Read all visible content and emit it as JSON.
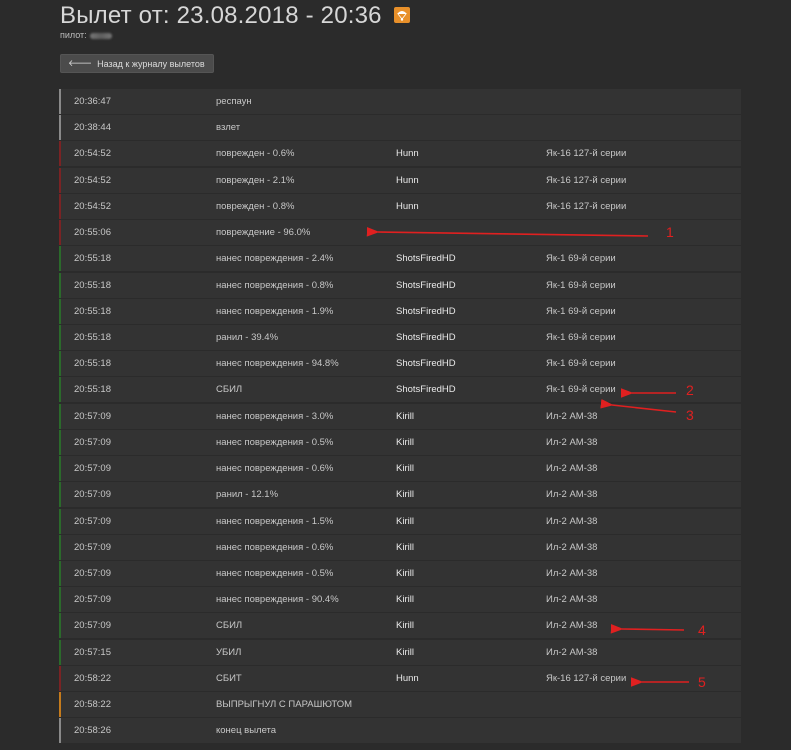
{
  "header": {
    "title": "Вылет от: 23.08.2018 - 20:36",
    "pilot_label": "пилот:"
  },
  "back_button": {
    "label": "Назад к журналу вылетов"
  },
  "colors": {
    "red": "#7a2324",
    "green": "#2b6a2b",
    "orange": "#c57b1c",
    "neutral": "#8a8a8a",
    "annotation": "#e02020"
  },
  "rows": [
    {
      "time": "20:36:47",
      "event": "респаун",
      "target": "",
      "aircraft": "",
      "marker": "neutral"
    },
    {
      "time": "20:38:44",
      "event": "взлет",
      "target": "",
      "aircraft": "",
      "marker": "neutral"
    },
    {
      "time": "20:54:52",
      "event": "поврежден - 0.6%",
      "target": "Hunn",
      "aircraft": "Як-16 127-й серии",
      "marker": "red"
    },
    {
      "time": "20:54:52",
      "event": "поврежден - 2.1%",
      "target": "Hunn",
      "aircraft": "Як-16 127-й серии",
      "marker": "red"
    },
    {
      "time": "20:54:52",
      "event": "поврежден - 0.8%",
      "target": "Hunn",
      "aircraft": "Як-16 127-й серии",
      "marker": "red"
    },
    {
      "time": "20:55:06",
      "event": "повреждение - 96.0%",
      "target": "",
      "aircraft": "",
      "marker": "red"
    },
    {
      "time": "20:55:18",
      "event": "нанес повреждения - 2.4%",
      "target": "ShotsFiredHD",
      "aircraft": "Як-1 69-й серии",
      "marker": "green"
    },
    {
      "time": "20:55:18",
      "event": "нанес повреждения - 0.8%",
      "target": "ShotsFiredHD",
      "aircraft": "Як-1 69-й серии",
      "marker": "green"
    },
    {
      "time": "20:55:18",
      "event": "нанес повреждения - 1.9%",
      "target": "ShotsFiredHD",
      "aircraft": "Як-1 69-й серии",
      "marker": "green"
    },
    {
      "time": "20:55:18",
      "event": "ранил - 39.4%",
      "target": "ShotsFiredHD",
      "aircraft": "Як-1 69-й серии",
      "marker": "green"
    },
    {
      "time": "20:55:18",
      "event": "нанес повреждения - 94.8%",
      "target": "ShotsFiredHD",
      "aircraft": "Як-1 69-й серии",
      "marker": "green"
    },
    {
      "time": "20:55:18",
      "event": "СБИЛ",
      "target": "ShotsFiredHD",
      "aircraft": "Як-1 69-й серии",
      "marker": "green"
    },
    {
      "time": "20:57:09",
      "event": "нанес повреждения - 3.0%",
      "target": "Kirill",
      "aircraft": "Ил-2 АМ-38",
      "marker": "green"
    },
    {
      "time": "20:57:09",
      "event": "нанес повреждения - 0.5%",
      "target": "Kirill",
      "aircraft": "Ил-2 АМ-38",
      "marker": "green"
    },
    {
      "time": "20:57:09",
      "event": "нанес повреждения - 0.6%",
      "target": "Kirill",
      "aircraft": "Ил-2 АМ-38",
      "marker": "green"
    },
    {
      "time": "20:57:09",
      "event": "ранил - 12.1%",
      "target": "Kirill",
      "aircraft": "Ил-2 АМ-38",
      "marker": "green"
    },
    {
      "time": "20:57:09",
      "event": "нанес повреждения - 1.5%",
      "target": "Kirill",
      "aircraft": "Ил-2 АМ-38",
      "marker": "green"
    },
    {
      "time": "20:57:09",
      "event": "нанес повреждения - 0.6%",
      "target": "Kirill",
      "aircraft": "Ил-2 АМ-38",
      "marker": "green"
    },
    {
      "time": "20:57:09",
      "event": "нанес повреждения - 0.5%",
      "target": "Kirill",
      "aircraft": "Ил-2 АМ-38",
      "marker": "green"
    },
    {
      "time": "20:57:09",
      "event": "нанес повреждения - 90.4%",
      "target": "Kirill",
      "aircraft": "Ил-2 АМ-38",
      "marker": "green"
    },
    {
      "time": "20:57:09",
      "event": "СБИЛ",
      "target": "Kirill",
      "aircraft": "Ил-2 АМ-38",
      "marker": "green"
    },
    {
      "time": "20:57:15",
      "event": "УБИЛ",
      "target": "Kirill",
      "aircraft": "Ил-2 АМ-38",
      "marker": "green"
    },
    {
      "time": "20:58:22",
      "event": "СБИТ",
      "target": "Hunn",
      "aircraft": "Як-16 127-й серии",
      "marker": "red"
    },
    {
      "time": "20:58:22",
      "event": "ВЫПРЫГНУЛ С ПАРАШЮТОМ",
      "target": "",
      "aircraft": "",
      "marker": "orange"
    },
    {
      "time": "20:58:26",
      "event": "конец вылета",
      "target": "",
      "aircraft": "",
      "marker": "neutral"
    }
  ],
  "annotations": [
    {
      "number": "1"
    },
    {
      "number": "2"
    },
    {
      "number": "3"
    },
    {
      "number": "4"
    },
    {
      "number": "5"
    }
  ]
}
